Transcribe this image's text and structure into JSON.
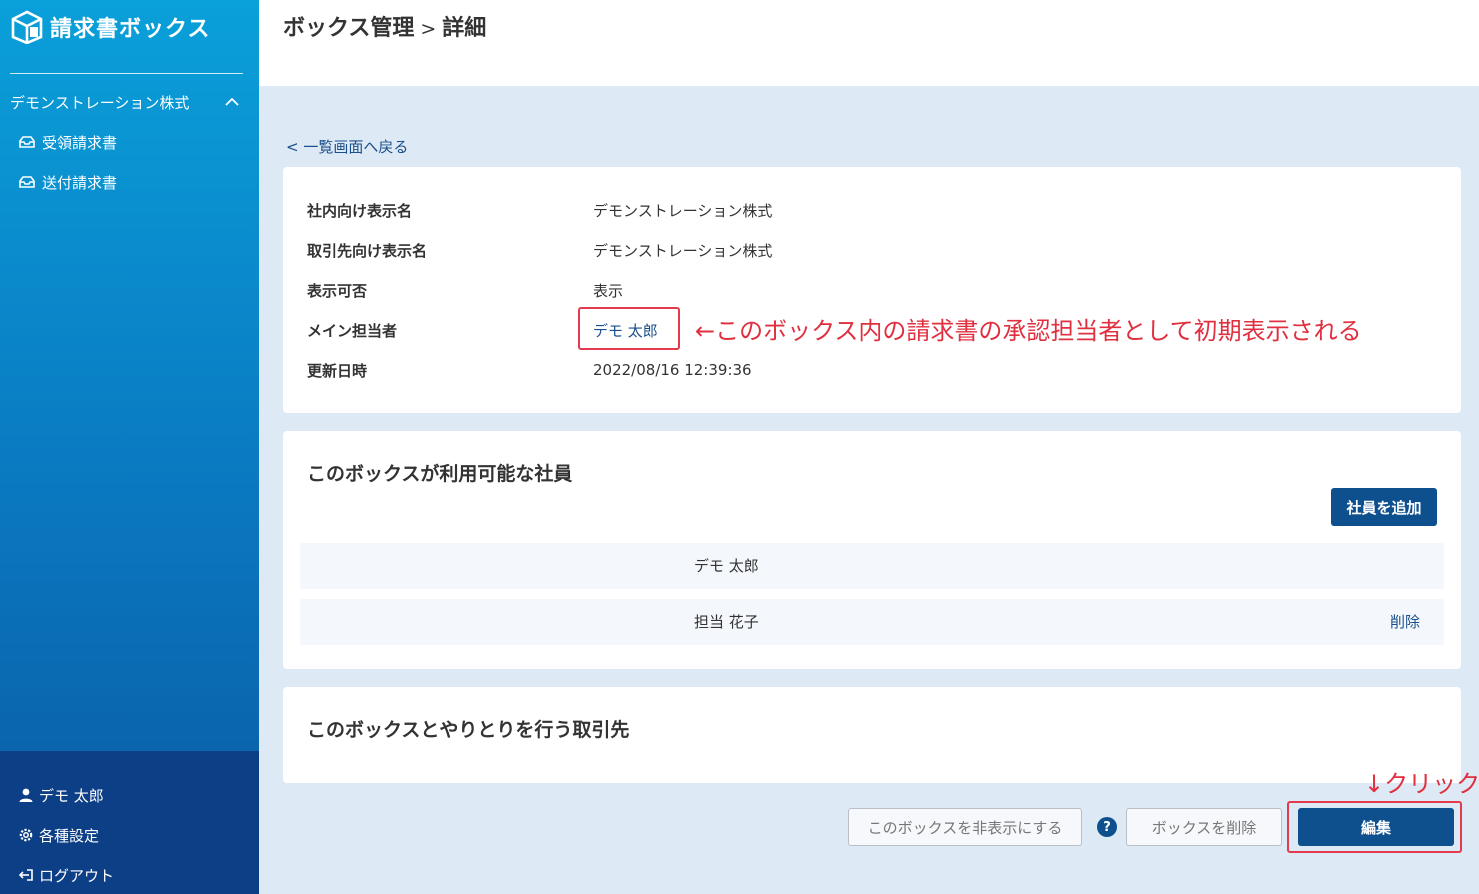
{
  "app": {
    "name": "請求書ボックス"
  },
  "sidebar": {
    "company": "デモンストレーション株式",
    "items": [
      {
        "label": "受領請求書",
        "icon": "inbox-icon"
      },
      {
        "label": "送付請求書",
        "icon": "inbox-icon"
      }
    ],
    "bottom": [
      {
        "label": "デモ 太郎",
        "icon": "user-icon"
      },
      {
        "label": "各種設定",
        "icon": "gear-icon"
      },
      {
        "label": "ログアウト",
        "icon": "logout-icon"
      }
    ]
  },
  "header": {
    "title_main": "ボックス管理",
    "separator": ">",
    "title_sub": "詳細"
  },
  "back_link": "< 一覧画面へ戻る",
  "details": {
    "rows": [
      {
        "label": "社内向け表示名",
        "value": "デモンストレーション株式"
      },
      {
        "label": "取引先向け表示名",
        "value": "デモンストレーション株式"
      },
      {
        "label": "表示可否",
        "value": "表示"
      },
      {
        "label": "メイン担当者",
        "value": "デモ 太郎"
      },
      {
        "label": "更新日時",
        "value": "2022/08/16 12:39:36"
      }
    ],
    "annotation": "←このボックス内の請求書の承認担当者として初期表示される"
  },
  "members": {
    "title": "このボックスが利用可能な社員",
    "add_button": "社員を追加",
    "list": [
      {
        "name": "デモ 太郎",
        "delete": ""
      },
      {
        "name": "担当 花子",
        "delete": "削除"
      }
    ]
  },
  "partners": {
    "title": "このボックスとやりとりを行う取引先"
  },
  "actions": {
    "hide_button": "このボックスを非表示にする",
    "help": "?",
    "delete_button": "ボックスを削除",
    "edit_button": "編集",
    "click_note": "↓クリック"
  },
  "colors": {
    "accent": "#0e4f8e",
    "link": "#1a4f8b",
    "annotation": "#e03040",
    "sidebar_top": "#0aa0da",
    "sidebar_bottom": "#0d3f86",
    "background": "#dde9f5"
  }
}
